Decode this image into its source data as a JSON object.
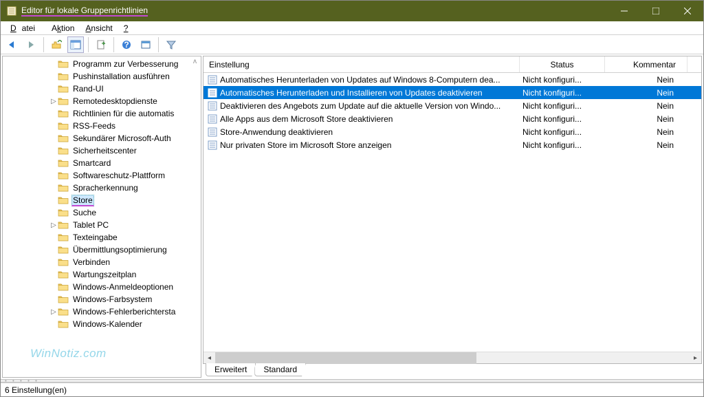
{
  "window": {
    "title": "Editor für lokale Gruppenrichtlinien"
  },
  "menu": {
    "items": [
      "Datei",
      "Aktion",
      "Ansicht",
      "?"
    ]
  },
  "tree": {
    "items": [
      {
        "label": "Programm zur Verbesserung",
        "indent": 64,
        "expander": ""
      },
      {
        "label": "Pushinstallation ausführen",
        "indent": 64,
        "expander": ""
      },
      {
        "label": "Rand-UI",
        "indent": 64,
        "expander": ""
      },
      {
        "label": "Remotedesktopdienste",
        "indent": 64,
        "expander": ">"
      },
      {
        "label": "Richtlinien für die automatis",
        "indent": 64,
        "expander": ""
      },
      {
        "label": "RSS-Feeds",
        "indent": 64,
        "expander": ""
      },
      {
        "label": "Sekundärer Microsoft-Auth",
        "indent": 64,
        "expander": ""
      },
      {
        "label": "Sicherheitscenter",
        "indent": 64,
        "expander": ""
      },
      {
        "label": "Smartcard",
        "indent": 64,
        "expander": ""
      },
      {
        "label": "Softwareschutz-Plattform",
        "indent": 64,
        "expander": ""
      },
      {
        "label": "Spracherkennung",
        "indent": 64,
        "expander": ""
      },
      {
        "label": "Store",
        "indent": 64,
        "expander": "",
        "selected": true,
        "underline": true
      },
      {
        "label": "Suche",
        "indent": 64,
        "expander": ""
      },
      {
        "label": "Tablet PC",
        "indent": 64,
        "expander": ">"
      },
      {
        "label": "Texteingabe",
        "indent": 64,
        "expander": ""
      },
      {
        "label": "Übermittlungsoptimierung",
        "indent": 64,
        "expander": ""
      },
      {
        "label": "Verbinden",
        "indent": 64,
        "expander": ""
      },
      {
        "label": "Wartungszeitplan",
        "indent": 64,
        "expander": ""
      },
      {
        "label": "Windows-Anmeldeoptionen",
        "indent": 64,
        "expander": ""
      },
      {
        "label": "Windows-Farbsystem",
        "indent": 64,
        "expander": ""
      },
      {
        "label": "Windows-Fehlerberichtersta",
        "indent": 64,
        "expander": ">"
      },
      {
        "label": "Windows-Kalender",
        "indent": 64,
        "expander": ""
      }
    ]
  },
  "list": {
    "columns": {
      "setting": "Einstellung",
      "status": "Status",
      "comment": "Kommentar"
    },
    "rows": [
      {
        "name": "Automatisches Herunterladen von Updates auf Windows 8-Computern dea...",
        "status": "Nicht konfiguri...",
        "comment": "Nein"
      },
      {
        "name": "Automatisches Herunterladen und Installieren von Updates deaktivieren",
        "status": "Nicht konfiguri...",
        "comment": "Nein",
        "selected": true,
        "underline": true
      },
      {
        "name": "Deaktivieren des Angebots zum Update auf die aktuelle Version von Windo...",
        "status": "Nicht konfiguri...",
        "comment": "Nein"
      },
      {
        "name": "Alle Apps aus dem Microsoft Store deaktivieren",
        "status": "Nicht konfiguri...",
        "comment": "Nein"
      },
      {
        "name": "Store-Anwendung deaktivieren",
        "status": "Nicht konfiguri...",
        "comment": "Nein"
      },
      {
        "name": "Nur privaten Store im Microsoft Store anzeigen",
        "status": "Nicht konfiguri...",
        "comment": "Nein"
      }
    ]
  },
  "tabs": {
    "erweitert": "Erweitert",
    "standard": "Standard"
  },
  "status": {
    "text": "6 Einstellung(en)"
  },
  "watermark": "WinNotiz.com"
}
